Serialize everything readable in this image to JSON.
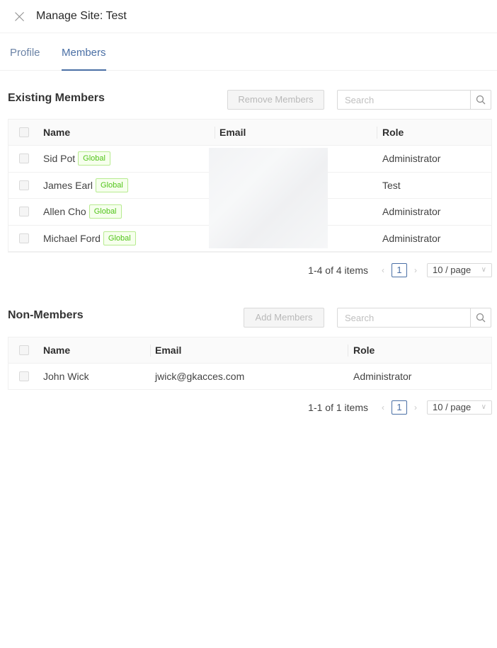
{
  "header": {
    "title": "Manage Site: Test"
  },
  "tabs": [
    {
      "label": "Profile"
    },
    {
      "label": "Members"
    }
  ],
  "existing": {
    "title": "Existing Members",
    "remove_button": "Remove Members",
    "search_placeholder": "Search",
    "columns": {
      "name": "Name",
      "email": "Email",
      "role": "Role"
    },
    "rows": [
      {
        "name": "Sid Pot",
        "tag": "Global",
        "role": "Administrator"
      },
      {
        "name": "James Earl",
        "tag": "Global",
        "role": "Test"
      },
      {
        "name": "Allen Cho",
        "tag": "Global",
        "role": "Administrator"
      },
      {
        "name": "Michael Ford",
        "tag": "Global",
        "role": "Administrator"
      }
    ],
    "pagination": {
      "total": "1-4 of 4 items",
      "page": "1",
      "page_size": "10 / page"
    }
  },
  "nonmembers": {
    "title": "Non-Members",
    "add_button": "Add Members",
    "search_placeholder": "Search",
    "columns": {
      "name": "Name",
      "email": "Email",
      "role": "Role"
    },
    "rows": [
      {
        "name": "John Wick",
        "email": "jwick@gkacces.com",
        "role": "Administrator"
      }
    ],
    "pagination": {
      "total": "1-1 of 1 items",
      "page": "1",
      "page_size": "10 / page"
    }
  },
  "colors": {
    "accent": "#4a6fa5",
    "tag_green": "#52c41a"
  },
  "icons": {
    "close": "close-icon",
    "search": "search-icon",
    "chevron": "chevron-down-icon"
  }
}
